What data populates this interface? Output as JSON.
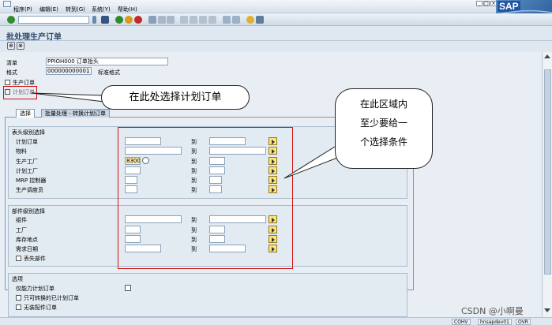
{
  "menubar": {
    "items": [
      "程序(P)",
      "编辑(E)",
      "转到(G)",
      "系统(Y)",
      "帮助(H)"
    ]
  },
  "brand": {
    "logo": "SAP",
    "accent": "#2d5f9c"
  },
  "window": {
    "title": "批处理生产订单"
  },
  "header": {
    "list_label": "清单",
    "list_value": "PPIOH000 订单抬头",
    "format_label": "格式",
    "format_value": "000000000001",
    "format_desc": "标准格式"
  },
  "order_type": {
    "production_order": "生产订单",
    "planned_order": "计划订单"
  },
  "tabs": [
    "选择",
    "批量处理 - 转换计划订单"
  ],
  "header_selection": {
    "title": "表头级别选择",
    "rows": [
      {
        "label": "计划订单",
        "from": "",
        "to_label": "到",
        "to": ""
      },
      {
        "label": "物料",
        "from": "",
        "to_label": "到",
        "to": ""
      },
      {
        "label": "生产工厂",
        "from": "8300",
        "to_label": "到",
        "to": ""
      },
      {
        "label": "计划工厂",
        "from": "",
        "to_label": "到",
        "to": ""
      },
      {
        "label": "MRP 控制器",
        "from": "",
        "to_label": "到",
        "to": ""
      },
      {
        "label": "生产调度员",
        "from": "",
        "to_label": "到",
        "to": ""
      }
    ]
  },
  "component_selection": {
    "title": "部件级别选择",
    "rows": [
      {
        "label": "组件",
        "from": "",
        "to_label": "到",
        "to": ""
      },
      {
        "label": "工厂",
        "from": "",
        "to_label": "到",
        "to": ""
      },
      {
        "label": "库存地点",
        "from": "",
        "to_label": "到",
        "to": ""
      },
      {
        "label": "需求日期",
        "from": "",
        "to_label": "到",
        "to": ""
      }
    ],
    "missing_parts": "丢失部件"
  },
  "options": {
    "title": "选项",
    "capacity_only": "仅能力计划订单",
    "converted_only": "只可转换的已计划订单",
    "no_assembly": "无装配件订单"
  },
  "annotations": {
    "select_here": "在此处选择计划订单",
    "area_note": [
      "在此区域内",
      "至少要给一",
      "个选择条件"
    ],
    "color": "#d01010"
  },
  "status": {
    "client": "COHV",
    "server": "hnsapdev01",
    "mode": "OVR"
  },
  "watermark": "CSDN @小啊曼"
}
